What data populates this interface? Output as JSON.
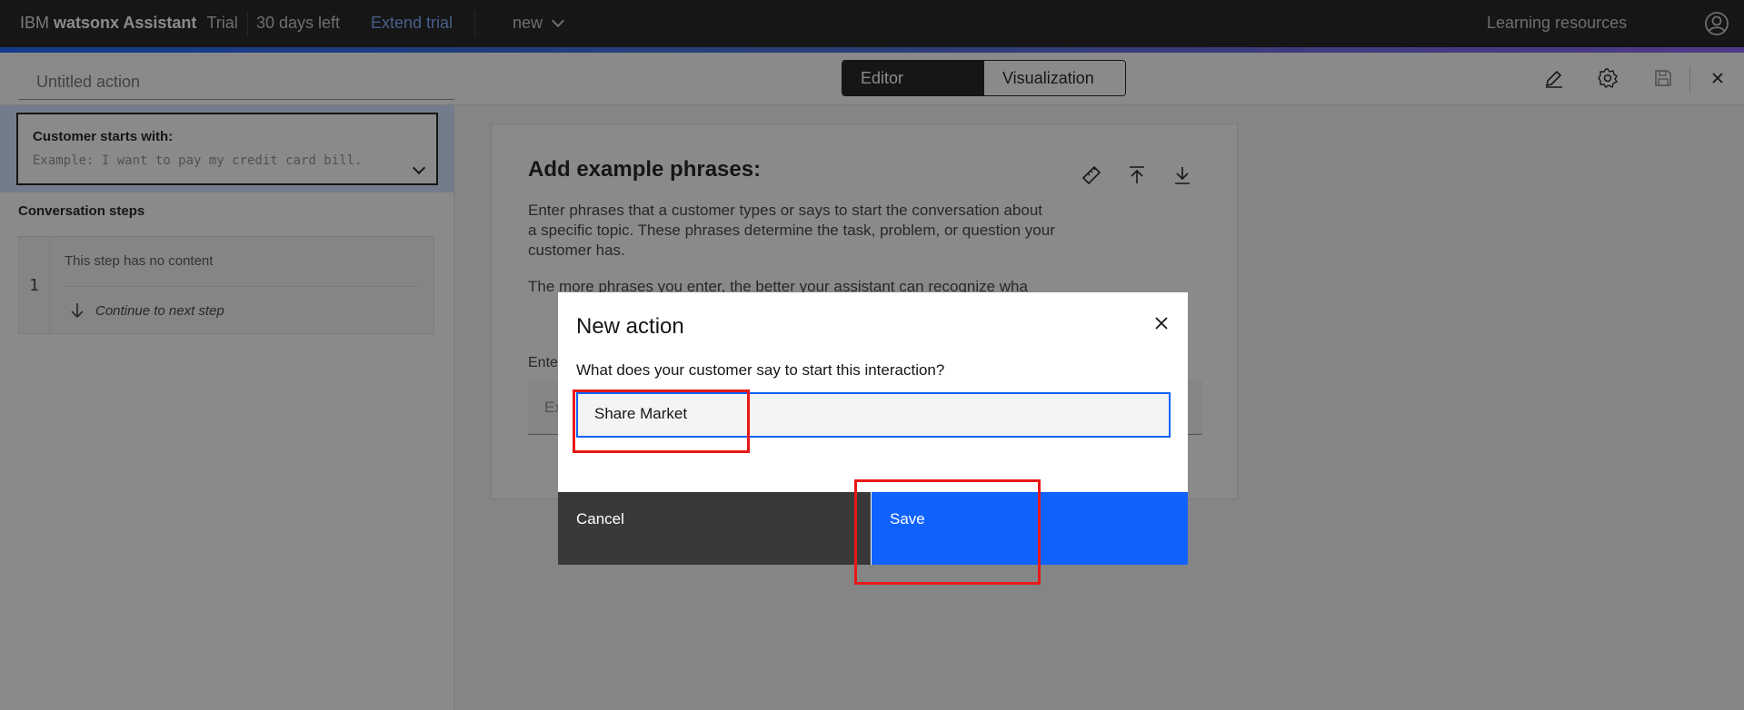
{
  "topbar": {
    "brand_prefix": "IBM",
    "brand_name": "watsonx Assistant",
    "plan": "Trial",
    "days_left": "30 days left",
    "extend_link": "Extend trial",
    "environment": "new",
    "learning_resources": "Learning resources",
    "icons": [
      "chevron-down-icon",
      "user-avatar-icon"
    ]
  },
  "subheader": {
    "action_title": "Untitled action",
    "tabs": [
      {
        "label": "Editor",
        "active": true
      },
      {
        "label": "Visualization",
        "active": false
      }
    ],
    "icons": [
      "edit-icon",
      "settings-icon",
      "save-icon",
      "close-icon"
    ]
  },
  "sidebar": {
    "starts_with_label": "Customer starts with:",
    "starts_with_example": "Example: I want to pay my credit card bill.",
    "conversation_steps_label": "Conversation steps",
    "steps": [
      {
        "number": "1",
        "content": "This step has no content",
        "next": "Continue to next step"
      }
    ]
  },
  "main": {
    "title": "Add example phrases:",
    "paragraph1": "Enter phrases that a customer types or says to start the conversation about a specific topic. These phrases determine the task, problem, or question your customer has.",
    "paragraph2": "The more phrases you enter, the better your assistant can recognize wha",
    "enter_label": "Ente",
    "input_placeholder": "Ex",
    "icons": [
      "ruler-icon",
      "upload-icon",
      "download-icon"
    ]
  },
  "modal": {
    "title": "New action",
    "question": "What does your customer say to start this interaction?",
    "input_value": "Share Market",
    "cancel_label": "Cancel",
    "save_label": "Save"
  },
  "colors": {
    "topbar_bg": "#161616",
    "primary_blue": "#0f62fe",
    "cancel_bg": "#393939",
    "highlight_red": "#e81818"
  }
}
